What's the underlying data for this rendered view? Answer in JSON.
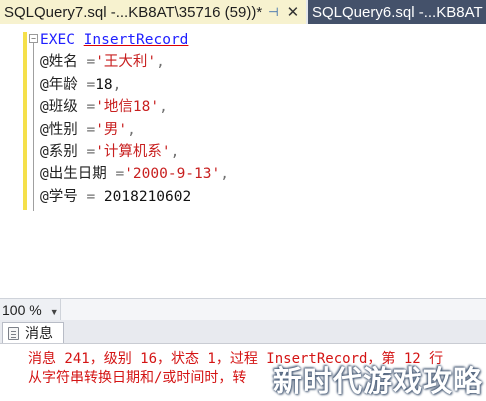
{
  "tabs": [
    {
      "label": "SQLQuery7.sql -...KB8AT\\35716 (59))*",
      "pin": "⊣",
      "close": "✕",
      "active": true
    },
    {
      "label": "SQLQuery6.sql -...KB8AT",
      "pin": "⊣",
      "active": false
    }
  ],
  "editor": {
    "fold_glyph": "−",
    "lines": [
      {
        "tokens": [
          [
            "kw",
            "EXEC"
          ],
          [
            "var",
            " "
          ],
          [
            "proc",
            "InsertRecord"
          ]
        ]
      },
      {
        "tokens": [
          [
            "var",
            "@姓名 "
          ],
          [
            "punc",
            "="
          ],
          [
            "str",
            "'王大利'"
          ],
          [
            "punc",
            ","
          ]
        ]
      },
      {
        "tokens": [
          [
            "var",
            "@年龄 "
          ],
          [
            "punc",
            "="
          ],
          [
            "num",
            "18"
          ],
          [
            "punc",
            ","
          ]
        ]
      },
      {
        "tokens": [
          [
            "var",
            "@班级 "
          ],
          [
            "punc",
            "="
          ],
          [
            "str",
            "'地信18'"
          ],
          [
            "punc",
            ","
          ]
        ]
      },
      {
        "tokens": [
          [
            "var",
            "@性别 "
          ],
          [
            "punc",
            "="
          ],
          [
            "str",
            "'男'"
          ],
          [
            "punc",
            ","
          ]
        ]
      },
      {
        "tokens": [
          [
            "var",
            "@系别 "
          ],
          [
            "punc",
            "="
          ],
          [
            "str",
            "'计算机系'"
          ],
          [
            "punc",
            ","
          ]
        ]
      },
      {
        "tokens": [
          [
            "var",
            "@出生日期 "
          ],
          [
            "punc",
            "="
          ],
          [
            "str",
            "'2000-9-13'"
          ],
          [
            "punc",
            ","
          ]
        ]
      },
      {
        "tokens": [
          [
            "var",
            "@学号 "
          ],
          [
            "punc",
            "="
          ],
          [
            "num",
            " 2018210602"
          ]
        ]
      }
    ]
  },
  "zoom": {
    "value": "100 %",
    "dropdown": "▼"
  },
  "results": {
    "tab_label": "消息",
    "messages": [
      "消息 241，级别 16，状态 1，过程 InsertRecord，第 12 行",
      "从字符串转换日期和/或时间时，转"
    ]
  },
  "watermark": "新时代游戏攻略"
}
